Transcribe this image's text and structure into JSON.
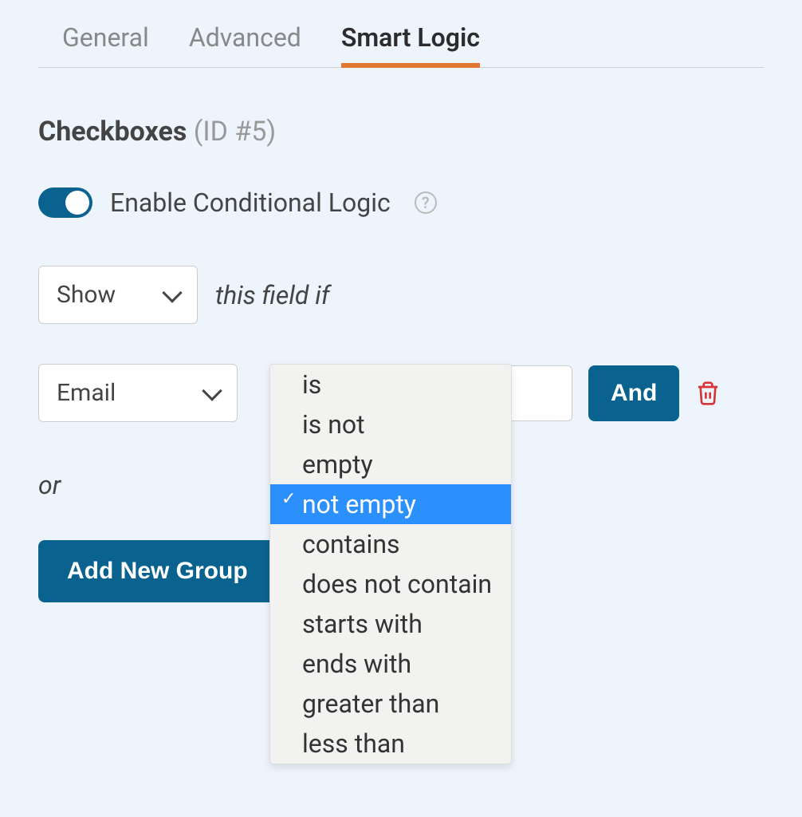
{
  "tabs": [
    {
      "label": "General",
      "active": false
    },
    {
      "label": "Advanced",
      "active": false
    },
    {
      "label": "Smart Logic",
      "active": true
    }
  ],
  "section": {
    "name": "Checkboxes",
    "id": "(ID #5)"
  },
  "toggle": {
    "label": "Enable Conditional Logic"
  },
  "show_select": {
    "value": "Show",
    "suffix": "this field if"
  },
  "condition": {
    "field": "Email",
    "and_label": "And"
  },
  "operator_options": [
    {
      "label": "is",
      "selected": false
    },
    {
      "label": "is not",
      "selected": false
    },
    {
      "label": "empty",
      "selected": false
    },
    {
      "label": "not empty",
      "selected": true
    },
    {
      "label": "contains",
      "selected": false
    },
    {
      "label": "does not contain",
      "selected": false
    },
    {
      "label": "starts with",
      "selected": false
    },
    {
      "label": "ends with",
      "selected": false
    },
    {
      "label": "greater than",
      "selected": false
    },
    {
      "label": "less than",
      "selected": false
    }
  ],
  "or_label": "or",
  "add_group_label": "Add New Group"
}
